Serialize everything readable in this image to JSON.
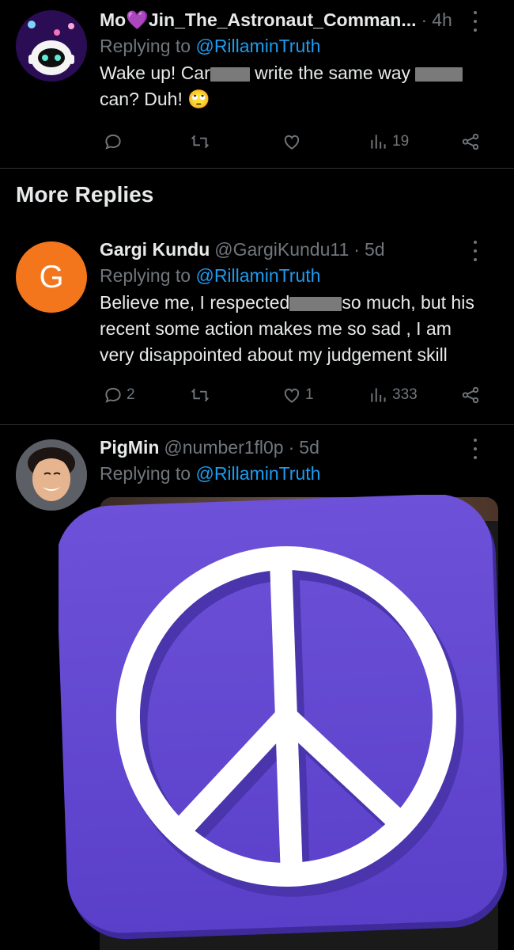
{
  "tweets": [
    {
      "name": "Mo💜Jin_The_Astronaut_Comman...",
      "handle": "",
      "dot": "·",
      "time": "4h",
      "replying_prefix": "Replying to ",
      "replying_handle": "@RillaminTruth",
      "text_parts": [
        "Wake up! Car",
        " write the same way ",
        "can? Duh! 🙄"
      ],
      "counts": {
        "reply": "",
        "retweet": "",
        "like": "",
        "views": "19"
      }
    },
    {
      "name": "Gargi Kundu",
      "handle": "@GargiKundu11",
      "dot": "·",
      "time": "5d",
      "avatar_letter": "G",
      "replying_prefix": "Replying to ",
      "replying_handle": "@RillaminTruth",
      "text_parts": [
        "Believe me, I respected",
        "so much, but his",
        "recent some action makes me so sad , I am",
        "very disappointed about my judgement skill"
      ],
      "counts": {
        "reply": "2",
        "retweet": "",
        "like": "1",
        "views": "333"
      }
    },
    {
      "name": "PigMin",
      "handle": "@number1fl0p",
      "dot": "·",
      "time": "5d",
      "replying_prefix": "Replying to ",
      "replying_handle": "@RillaminTruth"
    }
  ],
  "section_title": "More Replies",
  "colors": {
    "background": "#000000",
    "text": "#e7e9ea",
    "muted": "#71767b",
    "link": "#1d9bf0",
    "avatar_orange": "#f4761c",
    "peace_purple": "#6a4ed4"
  },
  "icons": [
    "reply-icon",
    "retweet-icon",
    "like-icon",
    "views-icon",
    "share-icon",
    "more-icon",
    "peace-sign-icon"
  ]
}
